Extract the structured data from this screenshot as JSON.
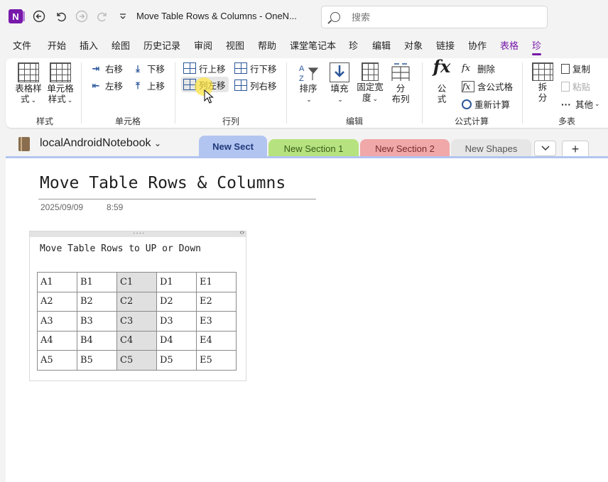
{
  "window": {
    "title": "Move Table Rows & Columns  -  OneN...",
    "search_placeholder": "搜索"
  },
  "menu": {
    "tabs": [
      "文件",
      "开始",
      "插入",
      "绘图",
      "历史记录",
      "审阅",
      "视图",
      "帮助",
      "课堂笔记本",
      "珍",
      "编辑",
      "对象",
      "链接",
      "协作",
      "表格",
      "珍"
    ]
  },
  "ribbon": {
    "styles": {
      "table_style": "表格样",
      "table_style2": "式",
      "cell_style": "单元格",
      "cell_style2": "样式",
      "label": "样式"
    },
    "cells": {
      "move_right": "右移",
      "move_left": "左移",
      "move_down": "下移",
      "move_up": "上移",
      "label": "单元格"
    },
    "rowcol": {
      "row_up": "行上移",
      "row_down": "行下移",
      "col_left": "列左移",
      "col_right": "列右移",
      "label": "行列"
    },
    "edit": {
      "sort": "排序",
      "fill": "填充",
      "fix_width": "固定宽",
      "fix_width2": "度",
      "distribute": "分",
      "distribute2": "布列",
      "label": "编辑"
    },
    "formula": {
      "formula": "公",
      "formula2": "式",
      "delete": "删除",
      "has_formula": "含公式格",
      "recalc": "重新计算",
      "label": "公式计算"
    },
    "multi": {
      "split": "拆",
      "split2": "分",
      "copy": "复制",
      "paste": "粘贴",
      "other": "其他",
      "label": "多表"
    }
  },
  "notebook": {
    "name": "localAndroidNotebook",
    "sections": [
      "New Sect",
      "New Section 1",
      "New Section 2",
      "New Shapes"
    ]
  },
  "page": {
    "title": "Move Table Rows & Columns",
    "date": "2025/09/09",
    "time": "8:59",
    "note_text": "Move Table Rows to UP or Down",
    "table": [
      [
        "A1",
        "B1",
        "C1",
        "D1",
        "E1"
      ],
      [
        "A2",
        "B2",
        "C2",
        "D2",
        "E2"
      ],
      [
        "A3",
        "B3",
        "C3",
        "D3",
        "E3"
      ],
      [
        "A4",
        "B4",
        "C4",
        "D4",
        "E4"
      ],
      [
        "A5",
        "B5",
        "C5",
        "D5",
        "E5"
      ]
    ]
  },
  "colors": {
    "accent": "#7719aa",
    "section_active": "#b2c4f0",
    "section_1": "#b6e37f",
    "section_2": "#f0a8a8",
    "section_3": "#e6e6e6"
  }
}
